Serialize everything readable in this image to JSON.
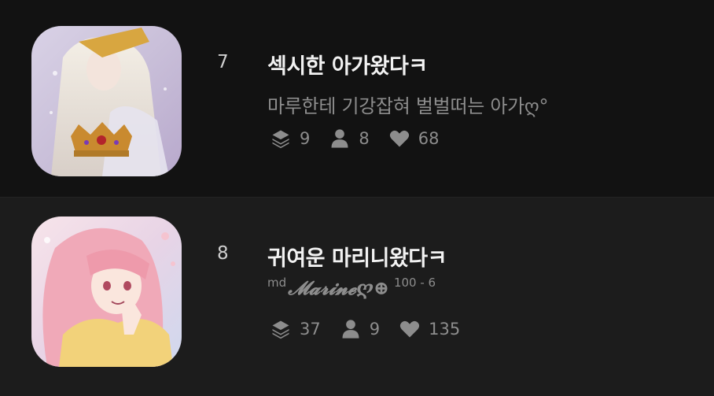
{
  "items": [
    {
      "rank": "7",
      "title": "섹시한 아가왔다ㅋ",
      "subtitle": "마루한테 기강잡혀 벌벌떠는 아가ღ°",
      "stats": {
        "episodes": "9",
        "users": "8",
        "likes": "68"
      },
      "icons": [
        "layers-icon",
        "person-icon",
        "heart-icon"
      ]
    },
    {
      "rank": "8",
      "title": "귀여운 마리니왔다ㅋ",
      "subtitle": {
        "prefix": "md",
        "script": "𝓜𝓪𝓻𝓲𝓷𝓮ღ⊕",
        "suffix": "100 - 6"
      },
      "stats": {
        "episodes": "37",
        "users": "9",
        "likes": "135"
      },
      "icons": [
        "layers-icon",
        "person-icon",
        "heart-icon"
      ]
    }
  ],
  "colors": {
    "background_row1": "#121212",
    "background_row2": "#1c1c1c",
    "title": "#f2f2f2",
    "muted": "#8d8d8d"
  }
}
